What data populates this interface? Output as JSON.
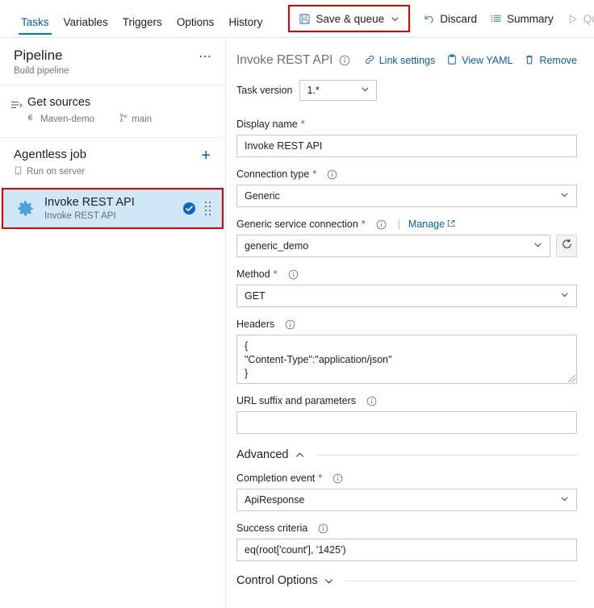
{
  "toolbar": {
    "tabs": [
      {
        "label": "Tasks",
        "active": true
      },
      {
        "label": "Variables",
        "active": false
      },
      {
        "label": "Triggers",
        "active": false
      },
      {
        "label": "Options",
        "active": false
      },
      {
        "label": "History",
        "active": false
      }
    ],
    "commands": [
      {
        "label": "Save & queue",
        "icon": "save-icon",
        "disabled": false,
        "has_chevron": true,
        "highlighted": true
      },
      {
        "label": "Discard",
        "icon": "undo-icon",
        "disabled": false
      },
      {
        "label": "Summary",
        "icon": "list-icon",
        "disabled": false
      },
      {
        "label": "Queue",
        "icon": "play-icon",
        "disabled": true
      },
      {
        "label": "…",
        "icon": "more-icon",
        "disabled": false
      }
    ],
    "expand_icon": "expand-diagonal-icon",
    "highlight_color": "#e60000",
    "accent_color": "#0078d4"
  },
  "sidebar": {
    "pipeline": {
      "title": "Pipeline",
      "subtitle": "Build pipeline",
      "more_icon": "ellipsis-icon"
    },
    "get_sources": {
      "title": "Get sources",
      "repo": "Maven-demo",
      "branch": "main",
      "icon": "sources-icon",
      "repo_icon": "git-repo-icon",
      "branch_icon": "branch-icon"
    },
    "job": {
      "title": "Agentless job",
      "subtitle": "Run on server",
      "subtitle_icon": "server-icon",
      "add_icon": "plus-icon"
    },
    "task": {
      "title": "Invoke REST API",
      "subtitle": "Invoke REST API",
      "icon": "gear-icon",
      "status_icon": "check-circle-icon",
      "drag_icon": "drag-handle-icon",
      "selected": true,
      "highlighted": true
    }
  },
  "panel": {
    "title": "Invoke REST API",
    "info_icon": "info-icon",
    "actions": [
      {
        "label": "Link settings",
        "icon": "link-icon"
      },
      {
        "label": "View YAML",
        "icon": "yaml-clipboard-icon"
      },
      {
        "label": "Remove",
        "icon": "trash-icon"
      }
    ],
    "task_version": {
      "label": "Task version",
      "value": "1.*",
      "chevron_icon": "chevron-down-icon"
    },
    "fields": {
      "display_name": {
        "label": "Display name",
        "required": true,
        "value": "Invoke REST API"
      },
      "connection_type": {
        "label": "Connection type",
        "required": true,
        "info_icon": "info-icon",
        "value": "Generic"
      },
      "generic_service_connection": {
        "label": "Generic service connection",
        "required": true,
        "info_icon": "info-icon",
        "manage_label": "Manage",
        "manage_icon": "external-link-icon",
        "value": "generic_demo",
        "refresh_icon": "refresh-icon"
      },
      "method": {
        "label": "Method",
        "required": true,
        "info_icon": "info-icon",
        "value": "GET"
      },
      "headers": {
        "label": "Headers",
        "required": false,
        "info_icon": "info-icon",
        "value": "{\n\"Content-Type\":\"application/json\"\n}"
      },
      "url_suffix": {
        "label": "URL suffix and parameters",
        "required": false,
        "info_icon": "info-icon",
        "value": ""
      }
    },
    "advanced": {
      "title": "Advanced",
      "expanded": true,
      "chevron_icon": "chevron-up-icon",
      "completion_event": {
        "label": "Completion event",
        "required": true,
        "info_icon": "info-icon",
        "value": "ApiResponse"
      },
      "success_criteria": {
        "label": "Success criteria",
        "required": false,
        "info_icon": "info-icon",
        "value": "eq(root['count'], '1425')"
      }
    },
    "control_options": {
      "title": "Control Options",
      "expanded": false,
      "chevron_icon": "chevron-down-icon"
    }
  }
}
